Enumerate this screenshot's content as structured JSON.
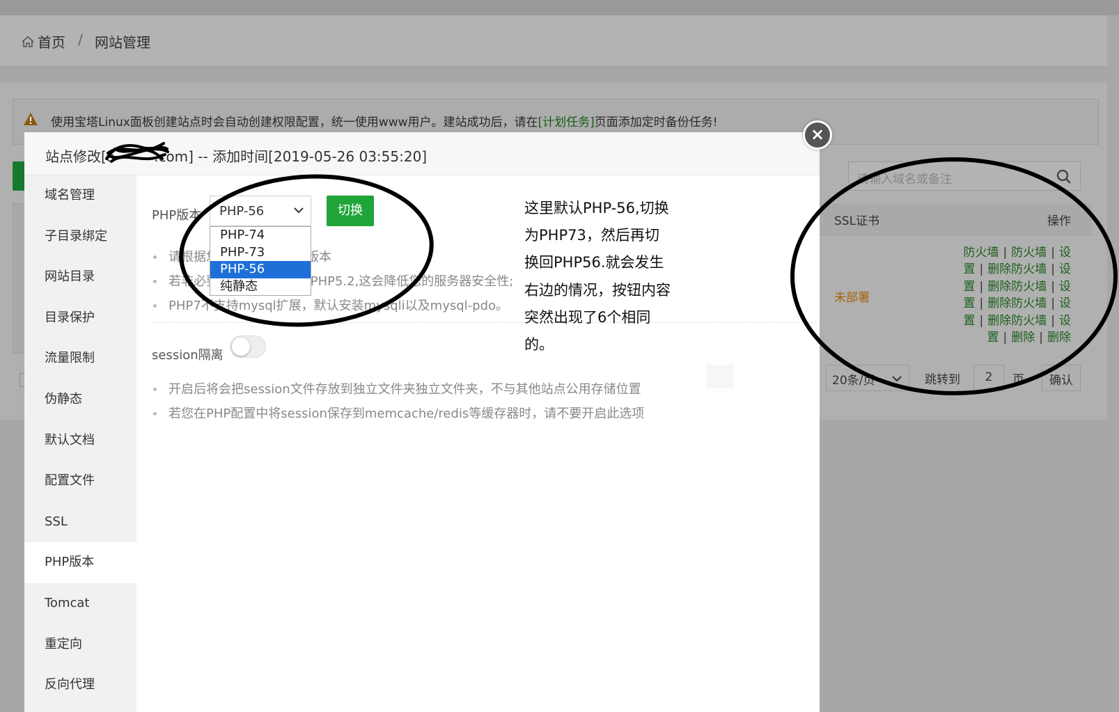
{
  "breadcrumb": {
    "home": "首页",
    "separator": "/",
    "current": "网站管理"
  },
  "alert": {
    "text_before": "使用宝塔Linux面板创建站点时会自动创建权限配置，统一使用www用户。建站成功后，请在",
    "link": "[计划任务]",
    "text_after": "页面添加定时备份任务!"
  },
  "search": {
    "placeholder": "请输入域名或备注"
  },
  "table": {
    "headers": {
      "ssl": "SSL证书",
      "actions": "操作"
    },
    "row": {
      "ssl_status": "未部署",
      "action_lines": [
        [
          "防火墙",
          "防火墙",
          "设"
        ],
        [
          "置",
          "删除防火墙",
          "设"
        ],
        [
          "置",
          "删除防火墙",
          "设"
        ],
        [
          "置",
          "删除防火墙",
          "设"
        ],
        [
          "置",
          "删除防火墙",
          "设"
        ],
        [
          "置",
          "删除",
          "删除"
        ]
      ],
      "separator": "|"
    }
  },
  "pager": {
    "page_size": "20条/页",
    "jump_to": "跳转到",
    "page": "2",
    "page_unit": "页",
    "confirm": "确认"
  },
  "modal": {
    "title_prefix": "站点修改[a",
    "title_suffix": ".com] -- 添加时间[2019-05-26 03:55:20]",
    "close": "×",
    "menu": [
      "域名管理",
      "子目录绑定",
      "网站目录",
      "目录保护",
      "流量限制",
      "伪静态",
      "默认文档",
      "配置文件",
      "SSL",
      "PHP版本",
      "Tomcat",
      "重定向",
      "反向代理"
    ],
    "active_menu": "PHP版本",
    "php": {
      "label": "PHP版本",
      "selected": "PHP-56",
      "options": [
        "PHP-74",
        "PHP-73",
        "PHP-56",
        "纯静态"
      ],
      "switch_button": "切换",
      "tips": [
        "请根据您的程序需求选择版本",
        "若非必要,请尽量不要使用PHP5.2,这会降低您的服务器安全性;",
        "PHP7不支持mysql扩展，默认安装mysqli以及mysql-pdo。"
      ]
    },
    "session": {
      "label": "session隔离",
      "enabled": false,
      "tips": [
        "开启后将会把session文件存放到独立文件夹独立文件夹，不与其他站点公用存储位置",
        "若您在PHP配置中将session保存到memcache/redis等缓存器时，请不要开启此选项"
      ]
    }
  },
  "annotation": {
    "lines": [
      "这里默认PHP-56,切换",
      "为PHP73，然后再切",
      "换回PHP56.就会发生",
      "右边的情况，按钮内容",
      "突然出现了6个相同",
      "的。"
    ]
  },
  "colors": {
    "accent_green": "#20a53a",
    "link_green": "#1b5f1b",
    "warn_orange": "#a6610a",
    "selected_blue": "#1e70d8"
  }
}
